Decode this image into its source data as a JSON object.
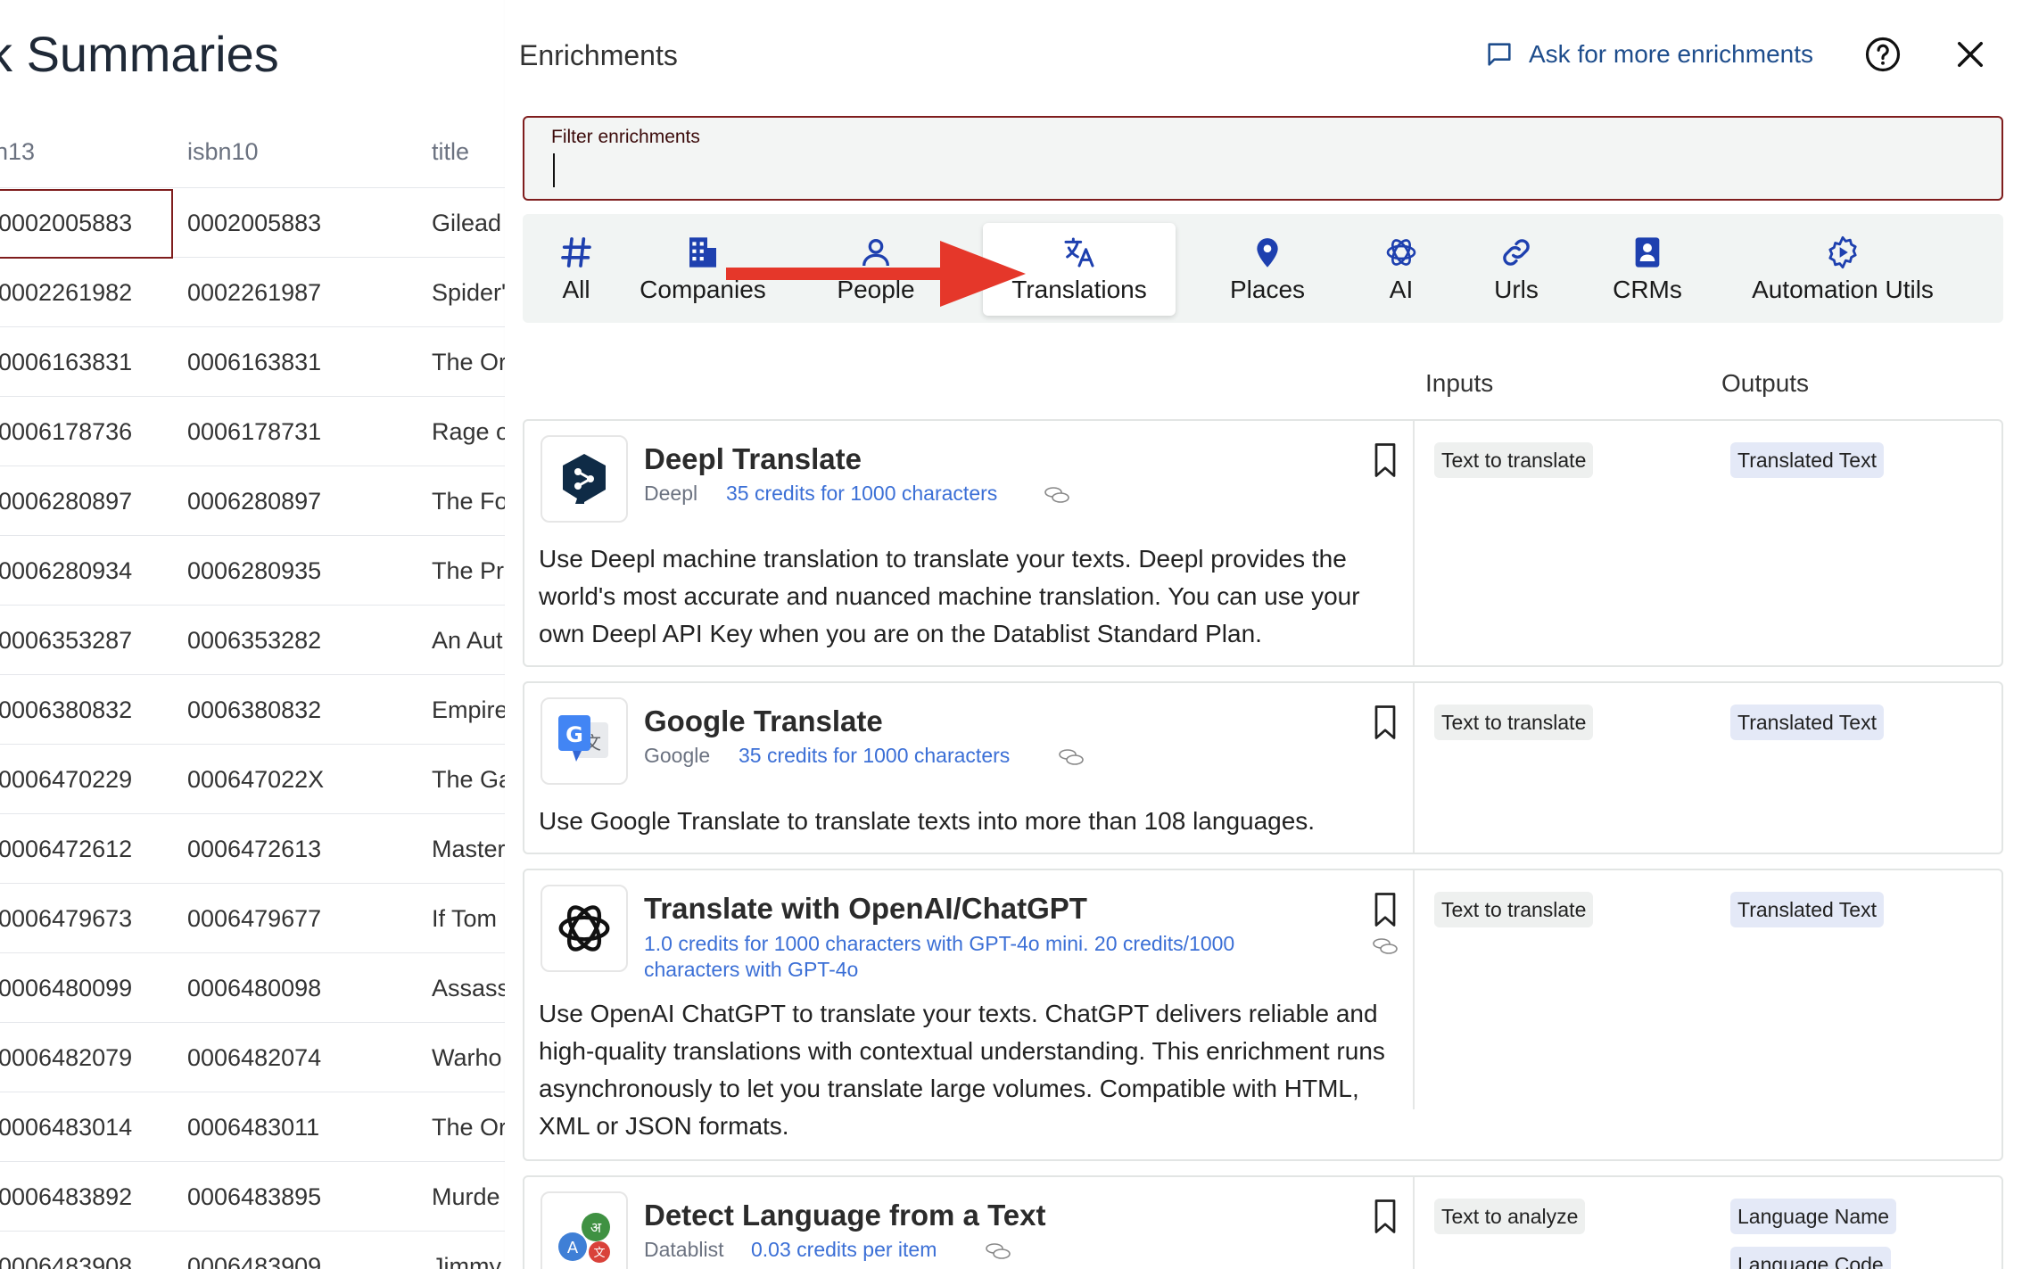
{
  "background": {
    "title": "Summaries",
    "columns": [
      "n13",
      "isbn10",
      "title"
    ],
    "rows": [
      [
        "0002005883",
        "0002005883",
        "Gilead"
      ],
      [
        "0002261982",
        "0002261987",
        "Spider'"
      ],
      [
        "0006163831",
        "0006163831",
        "The Or"
      ],
      [
        "0006178736",
        "0006178731",
        "Rage o"
      ],
      [
        "0006280897",
        "0006280897",
        "The Fo"
      ],
      [
        "0006280934",
        "0006280935",
        "The Pr"
      ],
      [
        "0006353287",
        "0006353282",
        "An Aut"
      ],
      [
        "0006380832",
        "0006380832",
        "Empire"
      ],
      [
        "0006470229",
        "000647022X",
        "The Ga"
      ],
      [
        "0006472612",
        "0006472613",
        "Master"
      ],
      [
        "0006479673",
        "0006479677",
        "If Tom"
      ],
      [
        "0006480099",
        "0006480098",
        "Assass"
      ],
      [
        "0006482079",
        "0006482074",
        "Warho"
      ],
      [
        "0006483014",
        "0006483011",
        "The Or"
      ],
      [
        "0006483892",
        "0006483895",
        "Murde"
      ],
      [
        "0006483908",
        "0006483909",
        "Jimmy"
      ]
    ]
  },
  "drawer": {
    "title": "Enrichments",
    "ask_label": "Ask for more enrichments",
    "filter_label": "Filter enrichments",
    "filter_value": "",
    "tabs": [
      {
        "label": "All",
        "icon": "hash-icon"
      },
      {
        "label": "Companies",
        "icon": "building-icon"
      },
      {
        "label": "People",
        "icon": "person-icon"
      },
      {
        "label": "Translations",
        "icon": "translate-icon",
        "active": true
      },
      {
        "label": "Places",
        "icon": "map-pin-icon"
      },
      {
        "label": "AI",
        "icon": "openai-icon"
      },
      {
        "label": "Urls",
        "icon": "link-icon"
      },
      {
        "label": "CRMs",
        "icon": "contact-card-icon"
      },
      {
        "label": "Automation Utils",
        "icon": "gear-play-icon"
      }
    ],
    "column_inputs": "Inputs",
    "column_outputs": "Outputs",
    "cards": [
      {
        "title": "Deepl Translate",
        "provider": "Deepl",
        "credits": "35 credits for 1000 characters",
        "description": "Use Deepl machine translation to translate your texts. Deepl provides the world's most accurate and nuanced machine translation. You can use your own Deepl API Key when you are on the Datablist Standard Plan.",
        "inputs": [
          "Text to translate"
        ],
        "outputs": [
          "Translated Text"
        ]
      },
      {
        "title": "Google Translate",
        "provider": "Google",
        "credits": "35 credits for 1000 characters",
        "description": "Use Google Translate to translate texts into more than 108 languages.",
        "inputs": [
          "Text to translate"
        ],
        "outputs": [
          "Translated Text"
        ]
      },
      {
        "title": "Translate with OpenAI/ChatGPT",
        "provider": "",
        "credits": "1.0 credits for 1000 characters with GPT-4o mini. 20 credits/1000 characters with GPT-4o",
        "description": "Use OpenAI ChatGPT to translate your texts. ChatGPT delivers reliable and high-quality translations with contextual understanding. This enrichment runs asynchronously to let you translate large volumes. Compatible with HTML, XML or JSON formats.",
        "inputs": [
          "Text to translate"
        ],
        "outputs": [
          "Translated Text"
        ]
      },
      {
        "title": "Detect Language from a Text",
        "provider": "Datablist",
        "credits": "0.03 credits per item",
        "description": "",
        "inputs": [
          "Text to analyze"
        ],
        "outputs": [
          "Language Name",
          "Language Code"
        ]
      }
    ]
  },
  "colors": {
    "accent_link": "#1e4d8c",
    "credits_blue": "#3b6fd6",
    "filter_border": "#7f1d1d",
    "tab_icon_blue": "#1e40af",
    "arrow_red": "#e5372a"
  }
}
